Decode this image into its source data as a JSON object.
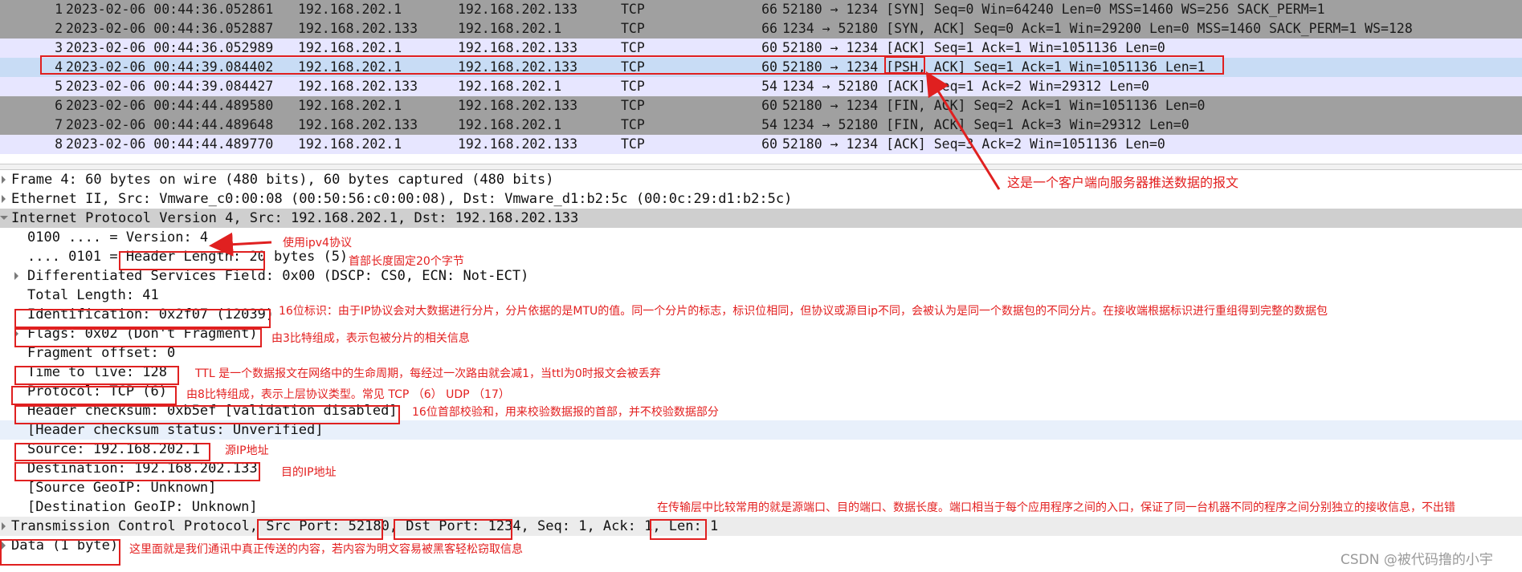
{
  "packets": [
    {
      "no": "1",
      "time": "2023-02-06 00:44:36.052861",
      "src": "192.168.202.1",
      "dst": "192.168.202.133",
      "proto": "TCP",
      "len": "66",
      "info": "52180 → 1234 [SYN] Seq=0 Win=64240 Len=0 MSS=1460 WS=256 SACK_PERM=1"
    },
    {
      "no": "2",
      "time": "2023-02-06 00:44:36.052887",
      "src": "192.168.202.133",
      "dst": "192.168.202.1",
      "proto": "TCP",
      "len": "66",
      "info": "1234 → 52180 [SYN, ACK] Seq=0 Ack=1 Win=29200 Len=0 MSS=1460 SACK_PERM=1 WS=128"
    },
    {
      "no": "3",
      "time": "2023-02-06 00:44:36.052989",
      "src": "192.168.202.1",
      "dst": "192.168.202.133",
      "proto": "TCP",
      "len": "60",
      "info": "52180 → 1234 [ACK] Seq=1 Ack=1 Win=1051136 Len=0"
    },
    {
      "no": "4",
      "time": "2023-02-06 00:44:39.084402",
      "src": "192.168.202.1",
      "dst": "192.168.202.133",
      "proto": "TCP",
      "len": "60",
      "info": "52180 → 1234 [PSH, ACK] Seq=1 Ack=1 Win=1051136 Len=1"
    },
    {
      "no": "5",
      "time": "2023-02-06 00:44:39.084427",
      "src": "192.168.202.133",
      "dst": "192.168.202.1",
      "proto": "TCP",
      "len": "54",
      "info": "1234 → 52180 [ACK] Seq=1 Ack=2 Win=29312 Len=0"
    },
    {
      "no": "6",
      "time": "2023-02-06 00:44:44.489580",
      "src": "192.168.202.1",
      "dst": "192.168.202.133",
      "proto": "TCP",
      "len": "60",
      "info": "52180 → 1234 [FIN, ACK] Seq=2 Ack=1 Win=1051136 Len=0"
    },
    {
      "no": "7",
      "time": "2023-02-06 00:44:44.489648",
      "src": "192.168.202.133",
      "dst": "192.168.202.1",
      "proto": "TCP",
      "len": "54",
      "info": "1234 → 52180 [FIN, ACK] Seq=1 Ack=3 Win=29312 Len=0"
    },
    {
      "no": "8",
      "time": "2023-02-06 00:44:44.489770",
      "src": "192.168.202.1",
      "dst": "192.168.202.133",
      "proto": "TCP",
      "len": "60",
      "info": "52180 → 1234 [ACK] Seq=3 Ack=2 Win=1051136 Len=0"
    }
  ],
  "row_colors": {
    "gray": "#a0a0a0",
    "lavender": "#e7e6ff",
    "selected": "#c8dcf5"
  },
  "details": [
    {
      "text": "Frame 4: 60 bytes on wire (480 bits), 60 bytes captured (480 bits)",
      "expander": "collapsed"
    },
    {
      "text": "Ethernet II, Src: Vmware_c0:00:08 (00:50:56:c0:00:08), Dst: Vmware_d1:b2:5c (00:0c:29:d1:b2:5c)",
      "expander": "collapsed"
    },
    {
      "text": "Internet Protocol Version 4, Src: 192.168.202.1, Dst: 192.168.202.133",
      "expander": "expanded"
    },
    {
      "text": "0100 .... = Version: 4",
      "expander": "none"
    },
    {
      "text": ".... 0101 = Header Length: 20 bytes (5)",
      "expander": "none"
    },
    {
      "text": "Differentiated Services Field: 0x00 (DSCP: CS0, ECN: Not-ECT)",
      "expander": "collapsed"
    },
    {
      "text": "Total Length: 41",
      "expander": "none"
    },
    {
      "text": "Identification: 0x2f07 (12039)",
      "expander": "none"
    },
    {
      "text": "Flags: 0x02 (Don't Fragment)",
      "expander": "collapsed"
    },
    {
      "text": "Fragment offset: 0",
      "expander": "none"
    },
    {
      "text": "Time to live: 128",
      "expander": "none"
    },
    {
      "text": "Protocol: TCP (6)",
      "expander": "none"
    },
    {
      "text": "Header checksum: 0xb5ef [validation disabled]",
      "expander": "none"
    },
    {
      "text": "[Header checksum status: Unverified]",
      "expander": "none"
    },
    {
      "text": "Source: 192.168.202.1",
      "expander": "none"
    },
    {
      "text": "Destination: 192.168.202.133",
      "expander": "none"
    },
    {
      "text": "[Source GeoIP: Unknown]",
      "expander": "none"
    },
    {
      "text": "[Destination GeoIP: Unknown]",
      "expander": "none"
    },
    {
      "text": "Transmission Control Protocol, Src Port: 52180, Dst Port: 1234, Seq: 1, Ack: 1, Len: 1",
      "expander": "collapsed"
    },
    {
      "text": "Data (1 byte)",
      "expander": "collapsed"
    }
  ],
  "annotations": {
    "push_packet": "这是一个客户端向服务器推送数据的报文",
    "version": "使用ipv4协议",
    "header_length": "首部长度固定20个字节",
    "identification": "16位标识：由于IP协议会对大数据进行分片，分片依据的是MTU的值。同一个分片的标志，标识位相同，但协议或源目ip不同，会被认为是同一个数据包的不同分片。在接收端根据标识进行重组得到完整的数据包",
    "flags": "由3比特组成，表示包被分片的相关信息",
    "ttl": "TTL 是一个数据报文在网络中的生命周期，每经过一次路由就会减1，当ttl为0时报文会被丢弃",
    "protocol": "由8比特组成，表示上层协议类型。常见  TCP （6）  UDP  （17）",
    "checksum": "16位首部校验和，用来校验数据报的首部，并不校验数据部分",
    "source": "源IP地址",
    "destination": "目的IP地址",
    "tcp": "在传输层中比较常用的就是源端口、目的端口、数据长度。端口相当于每个应用程序之间的入口，保证了同一台机器不同的程序之间分别独立的接收信息，不出错",
    "data": "这里面就是我们通讯中真正传送的内容，若内容为明文容易被黑客轻松窃取信息"
  },
  "watermark": "CSDN @被代码撸的小宇",
  "annotation_color": "#e02020"
}
